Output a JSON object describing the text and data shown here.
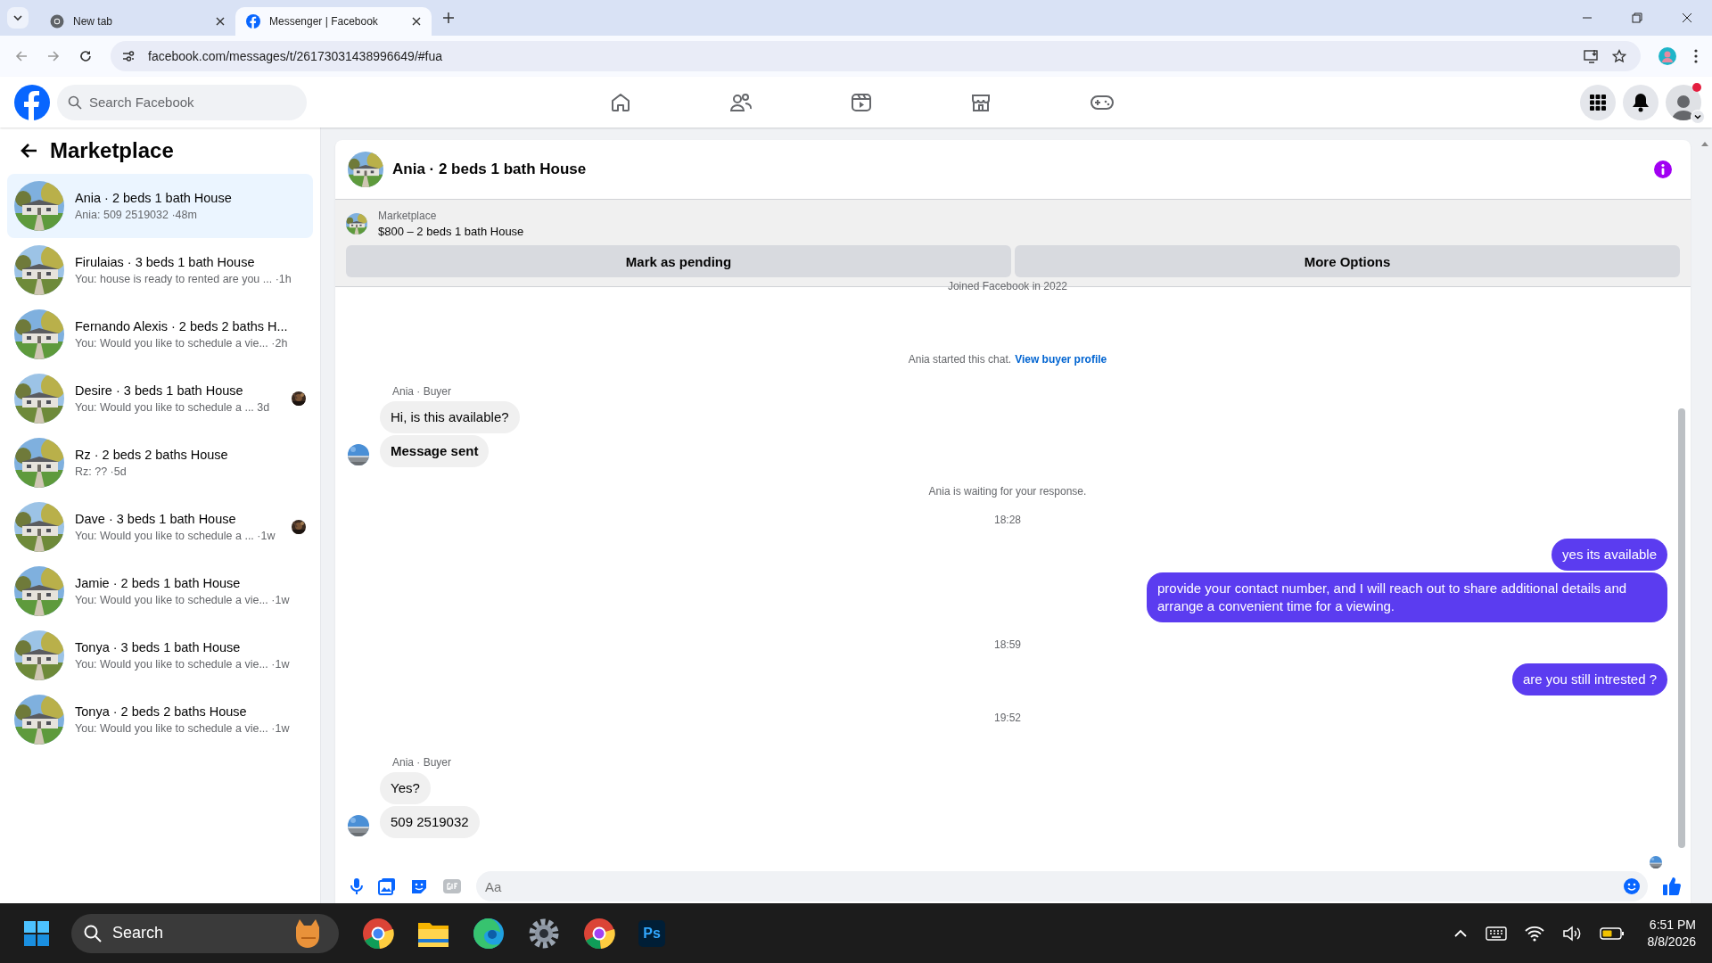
{
  "browser": {
    "tabs": [
      {
        "title": "New tab",
        "kind": "chrome",
        "selected": false
      },
      {
        "title": "Messenger | Facebook",
        "kind": "facebook",
        "selected": true
      }
    ],
    "url": "facebook.com/messages/t/26173031438996649/#fua"
  },
  "topbar": {
    "search": {
      "placeholder": "Search Facebook"
    },
    "profile_dot": true
  },
  "sidebar": {
    "title": "Marketplace",
    "items": [
      {
        "title": "Ania · 2 beds 1 bath House",
        "preview": "Ania: 509 2519032 ·48m",
        "selected": true,
        "seen": false
      },
      {
        "title": "Firulaias · 3 beds 1 bath House",
        "preview": "You: house is ready to rented are you ... ·1h",
        "selected": false,
        "seen": false
      },
      {
        "title": "Fernando Alexis · 2 beds 2 baths H...",
        "preview": "You: Would you like to schedule a vie...  ·2h",
        "selected": false,
        "seen": false
      },
      {
        "title": "Desire · 3 beds 1 bath House",
        "preview": "You: Would you like to schedule a ...   3d",
        "selected": false,
        "seen": true
      },
      {
        "title": "Rz · 2 beds 2 baths House",
        "preview": "Rz: ?? ·5d",
        "selected": false,
        "seen": false
      },
      {
        "title": "Dave · 3 beds 1 bath House",
        "preview": "You: Would you like to schedule a ... ·1w",
        "selected": false,
        "seen": true
      },
      {
        "title": "Jamie · 2 beds 1 bath House",
        "preview": "You: Would you like to schedule a vie... ·1w",
        "selected": false,
        "seen": false
      },
      {
        "title": "Tonya · 3 beds 1 bath House",
        "preview": "You: Would you like to schedule a vie... ·1w",
        "selected": false,
        "seen": false
      },
      {
        "title": "Tonya · 2 beds 2 baths House",
        "preview": "You: Would you like to schedule a vie... ·1w",
        "selected": false,
        "seen": false
      }
    ]
  },
  "chat": {
    "title": "Ania · 2 beds 1 bath House",
    "listing": {
      "label": "Marketplace",
      "price_title": "$800 – 2 beds 1 bath House",
      "buttons": [
        "Mark as pending",
        "More Options"
      ]
    },
    "messages": [
      {
        "kind": "notice",
        "text": "Joined Facebook in 2022"
      },
      {
        "kind": "notice",
        "text": "Ania started this chat.",
        "link": "View buyer profile"
      },
      {
        "kind": "incoming",
        "sender": "Ania · Buyer",
        "bubbles": [
          {
            "text": "Hi, is this available?",
            "bold": false
          },
          {
            "text": "Message sent",
            "bold": true
          }
        ]
      },
      {
        "kind": "notice",
        "text": "Ania is waiting for your response."
      },
      {
        "kind": "time",
        "text": "18:28"
      },
      {
        "kind": "outgoing",
        "bubbles": [
          {
            "text": "yes its available"
          },
          {
            "text": "provide your contact number, and I will reach out to share additional details and arrange a convenient time for a viewing."
          }
        ]
      },
      {
        "kind": "time",
        "text": "18:59"
      },
      {
        "kind": "outgoing",
        "bubbles": [
          {
            "text": "are you still intrested ?"
          }
        ]
      },
      {
        "kind": "time",
        "text": "19:52"
      },
      {
        "kind": "incoming",
        "sender": "Ania · Buyer",
        "bubbles": [
          {
            "text": "Yes?",
            "bold": false
          },
          {
            "text": "509 2519032",
            "bold": false
          }
        ]
      },
      {
        "kind": "seen"
      }
    ],
    "composer": {
      "placeholder": "Aa"
    }
  },
  "taskbar": {
    "search": "Search",
    "ps_label": "Ps",
    "time": "6:51 PM",
    "date": "8/8/2026"
  }
}
